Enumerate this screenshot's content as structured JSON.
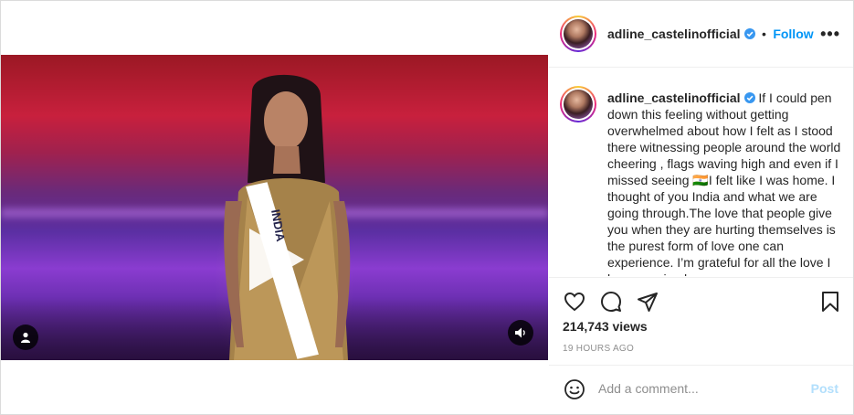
{
  "account": {
    "username": "adline_castelinofficial",
    "follow_label": "Follow",
    "separator": "•",
    "more_label": "•••"
  },
  "video": {
    "sash_text": "INDIA",
    "icons": {
      "play": "play-icon",
      "user": "user-tag-icon",
      "audio": "speaker-icon"
    }
  },
  "caption": {
    "username": "adline_castelinofficial",
    "text_part1": " If I could pen down this feeling without getting overwhelmed about how I felt as I stood there witnessing people around the world cheering , flags waving high and even if I missed seeing ",
    "flag_emoji": "🇮🇳",
    "text_part2": "I felt like I was home. I thought of you India and what we are going through.The love that people give you when they are hurting themselves is the purest form of love one can experience. I’m grateful for all the love I have received."
  },
  "stats": {
    "views": "214,743 views",
    "time_ago": "19 HOURS AGO"
  },
  "comment": {
    "placeholder": "Add a comment...",
    "post_label": "Post"
  },
  "colors": {
    "accent": "#0095f6",
    "post_disabled": "#b2dffc",
    "muted_text": "#8e8e8e",
    "verified": "#3897f0"
  }
}
